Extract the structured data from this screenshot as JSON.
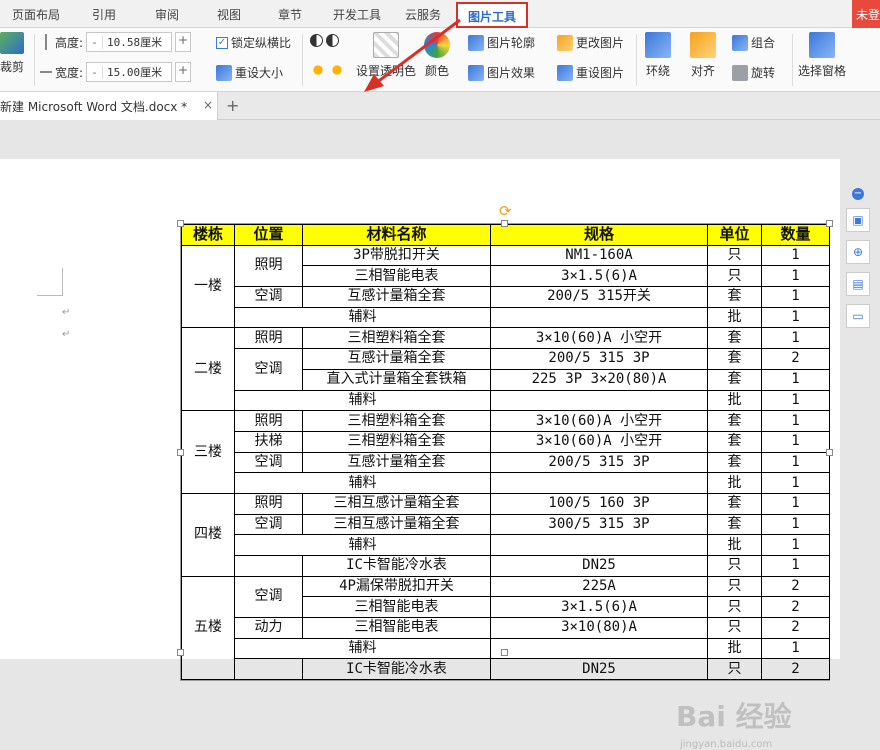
{
  "ribbon_tabs": [
    "页面布局",
    "引用",
    "审阅",
    "视图",
    "章节",
    "开发工具",
    "云服务",
    "图片工具"
  ],
  "active_tab": "图片工具",
  "unlogged_label": "未登录",
  "ribbon": {
    "crop_label": "裁剪",
    "height_label": "高度:",
    "height_value": "10.58厘米",
    "width_label": "宽度:",
    "width_value": "15.00厘米",
    "lock_ratio_label": "锁定纵横比",
    "reset_size_label": "重设大小",
    "transparent_label": "设置透明色",
    "color_label": "颜色",
    "outline_label": "图片轮廓",
    "effect_label": "图片效果",
    "change_pic_label": "更改图片",
    "reset_pic_label": "重设图片",
    "wrap_label": "环绕",
    "align_label": "对齐",
    "group_label": "组合",
    "rotate_label": "旋转",
    "selection_pane_label": "选择窗格",
    "plus": "+",
    "minus": "-"
  },
  "doc_tab": {
    "title": "新建 Microsoft Word 文档.docx *",
    "close": "×",
    "add": "+"
  },
  "table": {
    "headers": [
      "楼栋",
      "位置",
      "材料名称",
      "规格",
      "单位",
      "数量"
    ],
    "rows": [
      {
        "building": "一楼",
        "location": "照明",
        "material": "3P带脱扣开关",
        "spec": "NM1-160A",
        "unit": "只",
        "qty": "1"
      },
      {
        "material": "三相智能电表",
        "spec": "3×1.5(6)A",
        "unit": "只",
        "qty": "1"
      },
      {
        "location": "空调",
        "material": "互感计量箱全套",
        "spec": "200/5 315开关",
        "unit": "套",
        "qty": "1"
      },
      {
        "material": "辅料",
        "spec": "",
        "unit": "批",
        "qty": "1"
      },
      {
        "building": "二楼",
        "location": "照明",
        "material": "三相塑料箱全套",
        "spec": "3×10(60)A 小空开",
        "unit": "套",
        "qty": "1"
      },
      {
        "location": "空调",
        "material": "互感计量箱全套",
        "spec": "200/5 315 3P",
        "unit": "套",
        "qty": "2"
      },
      {
        "material": "直入式计量箱全套铁箱",
        "spec": "225 3P 3×20(80)A",
        "unit": "套",
        "qty": "1"
      },
      {
        "material": "辅料",
        "spec": "",
        "unit": "批",
        "qty": "1"
      },
      {
        "building": "三楼",
        "location": "照明",
        "material": "三相塑料箱全套",
        "spec": "3×10(60)A 小空开",
        "unit": "套",
        "qty": "1"
      },
      {
        "location": "扶梯",
        "material": "三相塑料箱全套",
        "spec": "3×10(60)A 小空开",
        "unit": "套",
        "qty": "1"
      },
      {
        "location": "空调",
        "material": "互感计量箱全套",
        "spec": "200/5 315 3P",
        "unit": "套",
        "qty": "1"
      },
      {
        "material": "辅料",
        "spec": "",
        "unit": "批",
        "qty": "1"
      },
      {
        "building": "四楼",
        "location": "照明",
        "material": "三相互感计量箱全套",
        "spec": "100/5 160 3P",
        "unit": "套",
        "qty": "1"
      },
      {
        "location": "空调",
        "material": "三相互感计量箱全套",
        "spec": "300/5 315 3P",
        "unit": "套",
        "qty": "1"
      },
      {
        "material": "辅料",
        "spec": "",
        "unit": "批",
        "qty": "1"
      },
      {
        "material": "IC卡智能冷水表",
        "spec": "DN25",
        "unit": "只",
        "qty": "1"
      },
      {
        "building": "五楼",
        "location": "空调",
        "material": "4P漏保带脱扣开关",
        "spec": "225A",
        "unit": "只",
        "qty": "2"
      },
      {
        "material": "三相智能电表",
        "spec": "3×1.5(6)A",
        "unit": "只",
        "qty": "2"
      },
      {
        "location": "动力",
        "material": "三相智能电表",
        "spec": "3×10(80)A",
        "unit": "只",
        "qty": "2"
      },
      {
        "material": "辅料",
        "spec": "",
        "unit": "批",
        "qty": "1"
      },
      {
        "material": "IC卡智能冷水表",
        "spec": "DN25",
        "unit": "只",
        "qty": "2"
      }
    ]
  },
  "watermark": "Bai 经验",
  "watermark_sub": "jingyan.baidu.com",
  "colors": {
    "header_bg": "#ffff00",
    "highlight": "#d93025",
    "accent": "#3b78d8"
  }
}
